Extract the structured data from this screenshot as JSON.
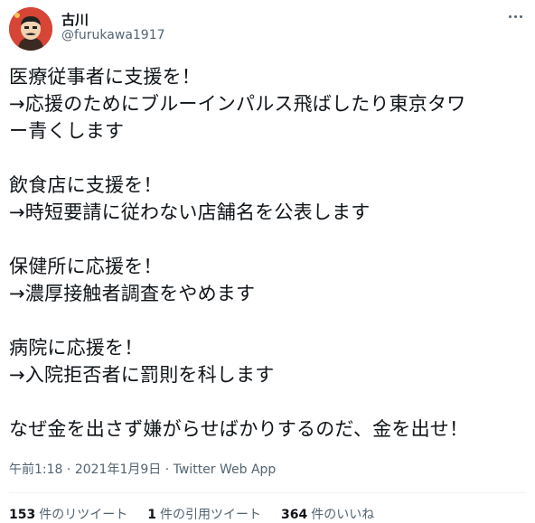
{
  "author": {
    "name": "古川",
    "handle": "@furukawa1917"
  },
  "tweet": {
    "paragraphs": [
      [
        "医療従事者に支援を！",
        "→応援のためにブルーインパルス飛ばしたり東京タワ",
        "ー青くします"
      ],
      [
        "飲食店に支援を！",
        "→時短要請に従わない店舗名を公表します"
      ],
      [
        "保健所に応援を！",
        "→濃厚接触者調査をやめます"
      ],
      [
        "病院に応援を！",
        "→入院拒否者に罰則を科します"
      ],
      [
        "なぜ金を出さず嫌がらせばかりするのだ、金を出せ！"
      ]
    ]
  },
  "meta": {
    "time": "午前1:18",
    "date": "2021年1月9日",
    "separator": " · ",
    "source": "Twitter Web App"
  },
  "stats": {
    "retweets_count": "153",
    "retweets_label": "件のリツイート",
    "quotes_count": "1",
    "quotes_label": "件の引用ツイート",
    "likes_count": "364",
    "likes_label": "件のいいね"
  },
  "colors": {
    "text": "#0f1419",
    "secondary": "#536471",
    "avatar_bg": "#d64535"
  }
}
